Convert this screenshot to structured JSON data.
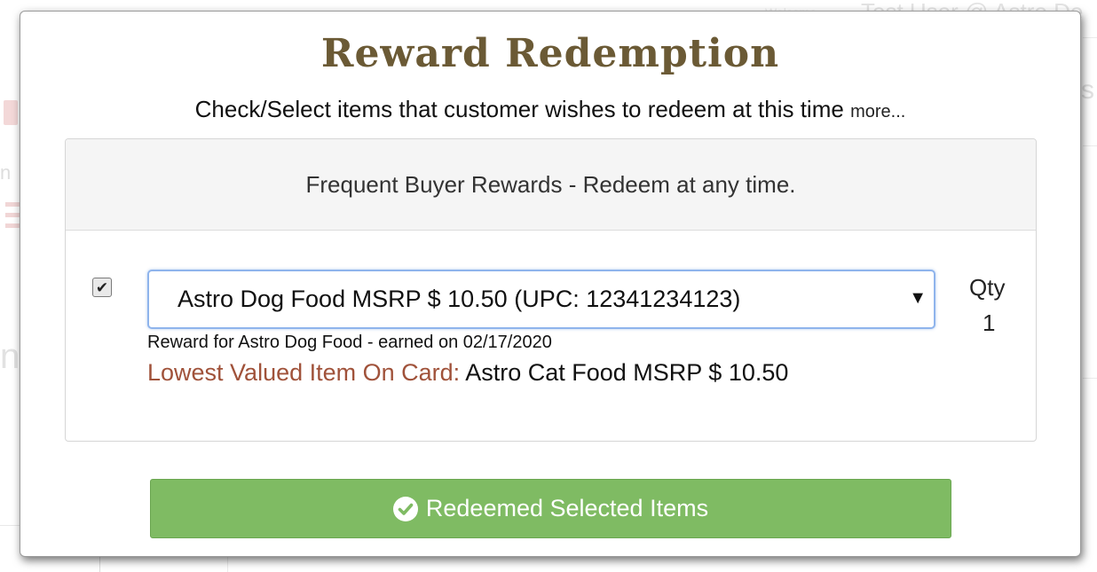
{
  "background": {
    "header_text": "Test User @ Astro De",
    "welcome_text": "Welcome",
    "left_letter_1": "n",
    "left_letter_2": "n",
    "right_letter": "s"
  },
  "modal": {
    "title": "Reward Redemption",
    "subtitle": "Check/Select items that customer wishes to redeem at this time",
    "more_link": "more...",
    "panel": {
      "heading": "Frequent Buyer Rewards - Redeem at any time.",
      "item": {
        "checked": true,
        "checkbox_mark": "✔",
        "select_value": "Astro Dog Food MSRP $ 10.50 (UPC: 12341234123)",
        "select_arrow": "▼",
        "qty_label": "Qty",
        "qty_value": "1",
        "reward_note": "Reward for Astro Dog Food - earned on 02/17/2020",
        "lowest_label": "Lowest Valued Item On Card:",
        "lowest_value": "Astro Cat Food MSRP $ 10.50"
      }
    },
    "redeem_button_label": "Redeemed Selected Items"
  },
  "colors": {
    "title": "#6b5a35",
    "button_green": "#7fbb63",
    "lowest_label": "#a0523a",
    "select_focus_border": "#8fb4ec"
  },
  "icons": {
    "redeem_button_icon": "check-circle-icon",
    "background_doc_icon": "document-icon",
    "background_menu_icon": "menu-icon"
  }
}
